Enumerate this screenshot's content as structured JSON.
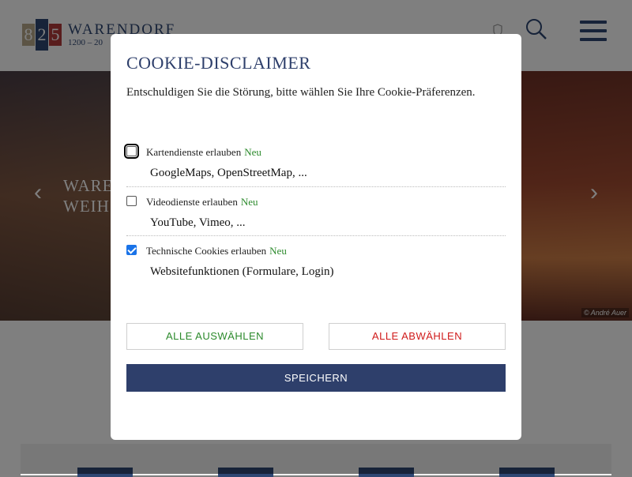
{
  "header": {
    "logo": {
      "digits": [
        "8",
        "2",
        "5"
      ],
      "title": "WARENDORF",
      "subtitle": "1200 – 20"
    },
    "search_icon": "search-icon",
    "menu_icon": "hamburger-menu-icon",
    "crest_icon": "crest-icon"
  },
  "hero": {
    "caption_line1": "WARE",
    "caption_line2": "WEIH",
    "copyright": "© André Auer",
    "prev_glyph": "‹",
    "next_glyph": "›"
  },
  "modal": {
    "title": "COOKIE-DISCLAIMER",
    "intro": "Entschuldigen Sie die Störung, bitte wählen Sie Ihre Cookie-Präferenzen.",
    "options": [
      {
        "label": "Kartendienste erlauben",
        "badge": "Neu",
        "description": "GoogleMaps, OpenStreetMap, ...",
        "checked": false
      },
      {
        "label": "Videodienste erlauben",
        "badge": "Neu",
        "description": "YouTube, Vimeo, ...",
        "checked": false
      },
      {
        "label": "Technische Cookies erlauben",
        "badge": "Neu",
        "description": "Websitefunktionen (Formulare, Login)",
        "checked": true
      }
    ],
    "select_all_label": "ALLE AUSWÄHLEN",
    "deselect_all_label": "ALLE ABWÄHLEN",
    "save_label": "SPEICHERN"
  },
  "colors": {
    "brand_navy": "#2e3f6b",
    "new_badge_green": "#2c8a2c",
    "deselect_red": "#d01b1b"
  }
}
